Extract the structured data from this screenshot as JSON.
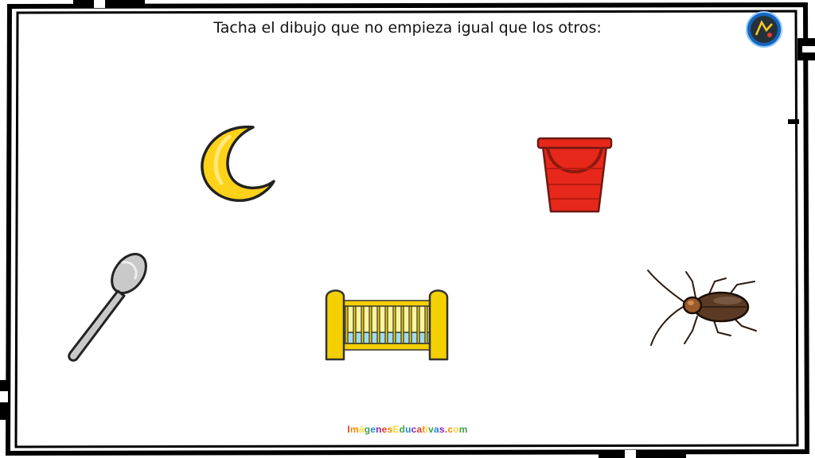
{
  "worksheet": {
    "instruction": "Tacha el dibujo que no empieza igual que los otros:",
    "footer_text": "ImágenesEducativas.com",
    "footer_colors": [
      "#e53935",
      "#fb8c00",
      "#fdd835",
      "#43a047",
      "#1e88e5",
      "#8e24aa"
    ],
    "pictures": [
      {
        "name": "moon",
        "icon": "moon-icon"
      },
      {
        "name": "bucket",
        "icon": "bucket-icon"
      },
      {
        "name": "spoon",
        "icon": "spoon-icon"
      },
      {
        "name": "crib",
        "icon": "crib-icon"
      },
      {
        "name": "cockroach",
        "icon": "cockroach-icon"
      }
    ]
  },
  "colors": {
    "moon": "#ffd21a",
    "bucket": "#e8271b",
    "spoon": "#c9c9c9",
    "crib": "#f5d000",
    "crib_mattress": "#9fdcef",
    "cockroach": "#5a3a24"
  }
}
